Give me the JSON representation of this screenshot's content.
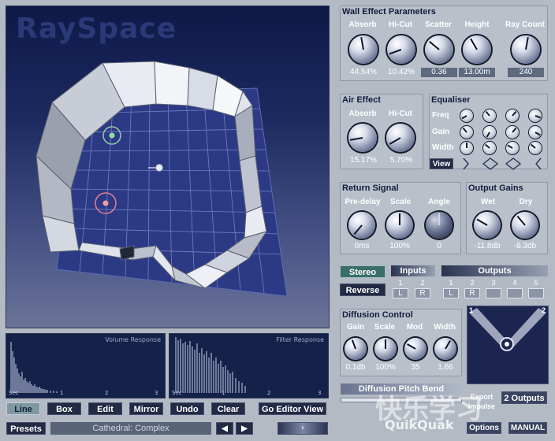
{
  "app": {
    "logo": "RaySpace"
  },
  "viewport": {
    "sources": [
      "green-source",
      "red-source"
    ],
    "listener": "listener"
  },
  "graphs": {
    "volume": {
      "title": "Volume Response",
      "ticks": [
        "Sec",
        "1",
        "2",
        "3"
      ]
    },
    "filter": {
      "title": "Filter Response",
      "ticks": [
        "Sec",
        "1",
        "2",
        "3"
      ]
    }
  },
  "toolbar": {
    "line": "Line",
    "box": "Box",
    "edit": "Edit",
    "mirror": "Mirror",
    "undo": "Undo",
    "clear": "Clear",
    "go_editor": "Go Editor View"
  },
  "presets": {
    "button": "Presets",
    "current": "Cathedral: Complex"
  },
  "wall": {
    "title": "Wall Effect Parameters",
    "params": [
      {
        "label": "Absorb",
        "value": "44.54%"
      },
      {
        "label": "Hi-Cut",
        "value": "10.42%"
      },
      {
        "label": "Scatter",
        "value": "0.36"
      },
      {
        "label": "Height",
        "value": "13.00m"
      }
    ],
    "raycount": {
      "label": "Ray Count",
      "value": "240"
    }
  },
  "air": {
    "title": "Air Effect",
    "params": [
      {
        "label": "Absorb",
        "value": "15.17%"
      },
      {
        "label": "Hi-Cut",
        "value": "5.70%"
      }
    ]
  },
  "eq": {
    "title": "Equaliser",
    "rows": [
      "Freq",
      "Gain",
      "Width"
    ],
    "view": "View"
  },
  "return_signal": {
    "title": "Return Signal",
    "params": [
      {
        "label": "Pre-delay",
        "value": "0ms"
      },
      {
        "label": "Scale",
        "value": "100%"
      },
      {
        "label": "Angle",
        "value": "0"
      }
    ]
  },
  "output_gains": {
    "title": "Output Gains",
    "params": [
      {
        "label": "Wet",
        "value": "-11.8db"
      },
      {
        "label": "Dry",
        "value": "-8.3db"
      }
    ]
  },
  "routing": {
    "stereo": "Stereo",
    "reverse": "Reverse",
    "inputs": {
      "title": "Inputs",
      "nums": [
        "1",
        "2"
      ],
      "vals": [
        "L",
        "R"
      ]
    },
    "outputs": {
      "title": "Outputs",
      "nums": [
        "1",
        "2",
        "3",
        "4",
        "5"
      ],
      "vals": [
        "L",
        "R",
        "",
        "",
        ""
      ]
    }
  },
  "diffusion": {
    "title": "Diffusion Control",
    "params": [
      {
        "label": "Gain",
        "value": "0.1db"
      },
      {
        "label": "Scale",
        "value": "100%"
      },
      {
        "label": "Mod",
        "value": "35"
      },
      {
        "label": "Width",
        "value": "1.66"
      }
    ]
  },
  "speaker_nums": [
    "1",
    "2"
  ],
  "diffusion_pitch": "Diffusion Pitch Bend",
  "export": {
    "label": "Export Impulse"
  },
  "outputs_count": "2 Outputs",
  "options": "Options",
  "manual": "MANUAL",
  "watermark": {
    "cn": "快乐学习",
    "en": "QuikQuak"
  }
}
